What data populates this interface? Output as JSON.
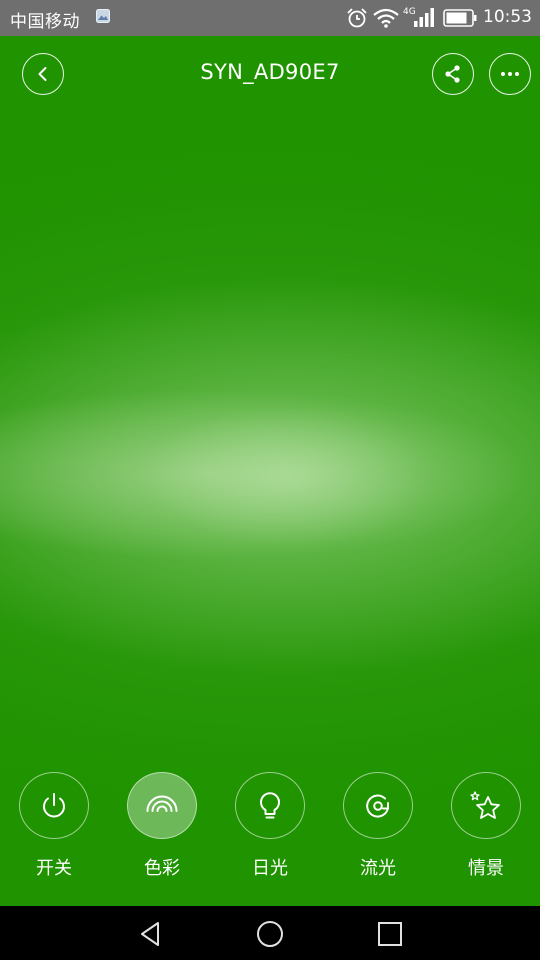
{
  "status_bar": {
    "carrier": "中国移动",
    "network_type": "4G",
    "time": "10:53",
    "icons": [
      "gallery-icon",
      "alarm-icon",
      "wifi-icon",
      "signal-icon",
      "battery-icon"
    ]
  },
  "header": {
    "title": "SYN_AD90E7",
    "back_icon": "chevron-left-icon",
    "share_icon": "share-icon",
    "more_icon": "more-dots-icon"
  },
  "color_preview": {
    "base_color": "#1f9300",
    "glow_color": "#9fd88a"
  },
  "bottom_tabs": [
    {
      "label": "开关",
      "icon": "power-icon",
      "active": false
    },
    {
      "label": "色彩",
      "icon": "rainbow-icon",
      "active": true
    },
    {
      "label": "日光",
      "icon": "bulb-icon",
      "active": false
    },
    {
      "label": "流光",
      "icon": "flow-icon",
      "active": false
    },
    {
      "label": "情景",
      "icon": "star-icon",
      "active": false
    }
  ],
  "nav_bar": {
    "icons": [
      "back-triangle-icon",
      "home-circle-icon",
      "recent-square-icon"
    ]
  }
}
